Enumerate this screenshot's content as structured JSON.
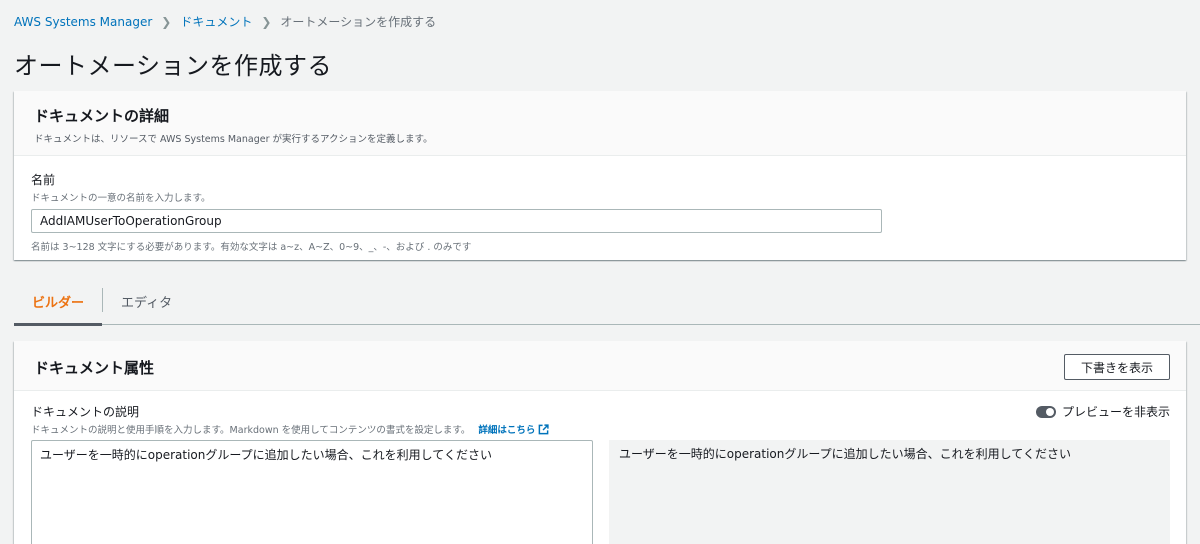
{
  "breadcrumb": {
    "items": [
      "AWS Systems Manager",
      "ドキュメント"
    ],
    "current": "オートメーションを作成する"
  },
  "page_title": "オートメーションを作成する",
  "details": {
    "title": "ドキュメントの詳細",
    "description": "ドキュメントは、リソースで AWS Systems Manager が実行するアクションを定義します。",
    "name_label": "名前",
    "name_description": "ドキュメントの一意の名前を入力します。",
    "name_value": "AddIAMUserToOperationGroup",
    "name_constraint": "名前は 3~128 文字にする必要があります。有効な文字は a~z、A~Z、0~9、_、-、および . のみです"
  },
  "tabs": [
    {
      "label": "ビルダー",
      "active": true
    },
    {
      "label": "エディタ",
      "active": false
    }
  ],
  "attributes": {
    "title": "ドキュメント属性",
    "view_draft_button": "下書きを表示",
    "desc_label": "ドキュメントの説明",
    "desc_help": "ドキュメントの説明と使用手順を入力します。Markdown を使用してコンテンツの書式を設定します。",
    "learn_more": "詳細はこちら",
    "preview_toggle_label": "プレビューを非表示",
    "description_value": "ユーザーを一時的にoperationグループに追加したい場合、これを利用してください",
    "preview_text": "ユーザーを一時的にoperationグループに追加したい場合、これを利用してください"
  },
  "colors": {
    "link": "#0073bb",
    "active_tab": "#ec7211",
    "background": "#f2f3f3"
  }
}
